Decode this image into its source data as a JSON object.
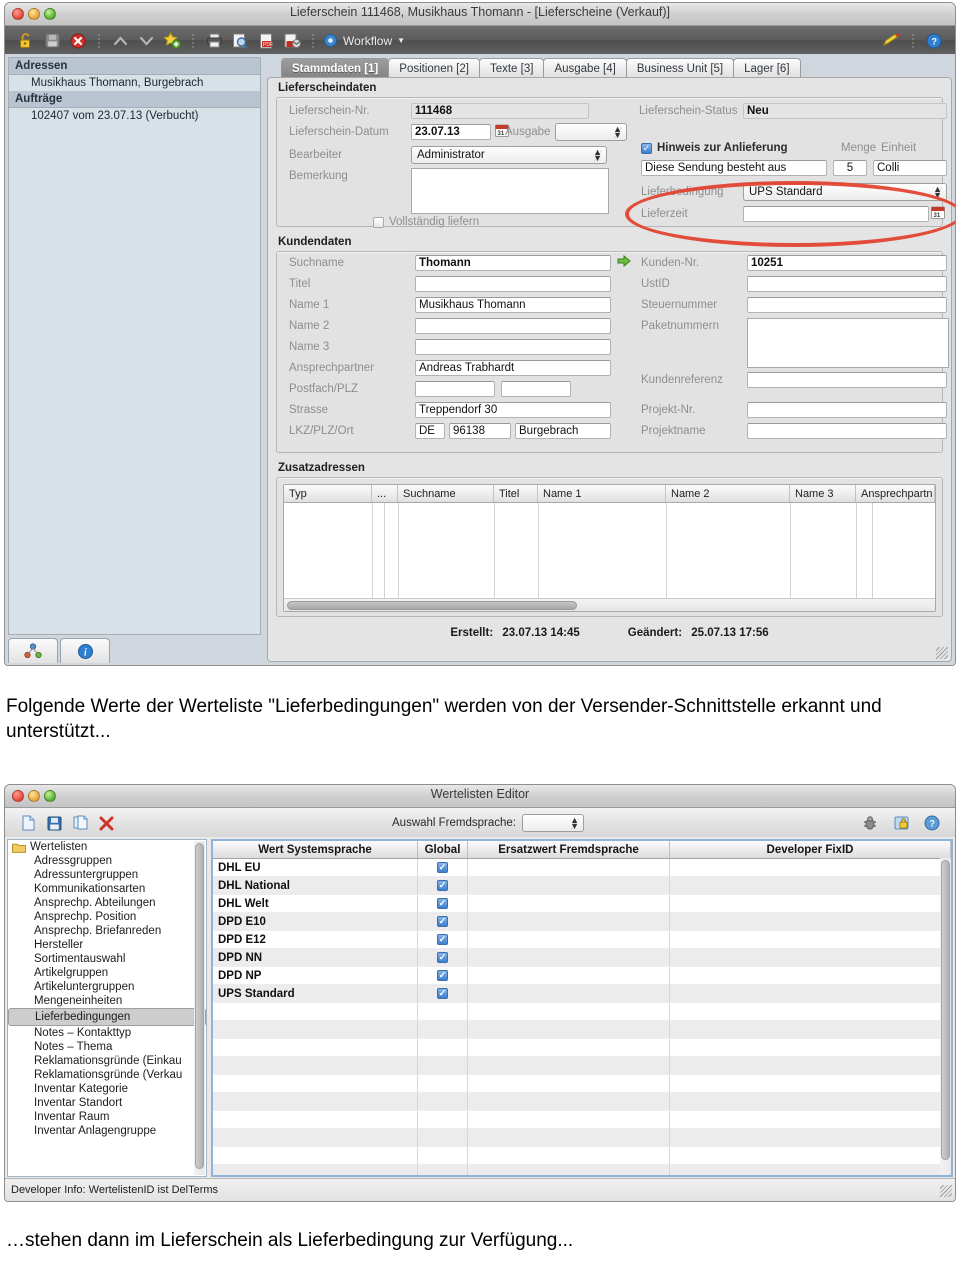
{
  "window1": {
    "title": "Lieferschein 111468, Musikhaus Thomann - [Lieferscheine (Verkauf)]",
    "toolbar": {
      "icons": [
        {
          "name": "unlock-icon",
          "glyph": "🔓"
        },
        {
          "name": "save-disk-icon",
          "glyph": "💾"
        },
        {
          "name": "delete-cancel-icon",
          "glyph": "✖"
        },
        {
          "name": "nav-up-icon",
          "glyph": "∧"
        },
        {
          "name": "nav-down-icon",
          "glyph": "∨"
        },
        {
          "name": "new-star-icon",
          "glyph": "★"
        },
        {
          "name": "print-icon",
          "glyph": "⎙"
        },
        {
          "name": "print-preview-icon",
          "glyph": "🔍"
        },
        {
          "name": "pdf-export-icon",
          "glyph": "📕"
        },
        {
          "name": "pdf-mail-icon",
          "glyph": "✉"
        }
      ],
      "workflow_label": "Workflow",
      "right_icons": [
        {
          "name": "highlight-pen-icon",
          "glyph": "✎"
        },
        {
          "name": "help-icon",
          "glyph": "?"
        }
      ]
    },
    "sidebar": {
      "groups": [
        {
          "label": "Adressen",
          "items": [
            "Musikhaus Thomann, Burgebrach"
          ]
        },
        {
          "label": "Aufträge",
          "items": [
            "102407 vom 23.07.13 (Verbucht)"
          ]
        }
      ],
      "bottom_tabs": [
        {
          "name": "relations-tab",
          "glyph": "⚬"
        },
        {
          "name": "info-tab",
          "glyph": "i"
        }
      ]
    },
    "tabs": [
      {
        "label": "Stammdaten [1]",
        "active": true
      },
      {
        "label": "Positionen [2]",
        "active": false
      },
      {
        "label": "Texte [3]",
        "active": false
      },
      {
        "label": "Ausgabe [4]",
        "active": false
      },
      {
        "label": "Business Unit [5]",
        "active": false
      },
      {
        "label": "Lager [6]",
        "active": false
      }
    ],
    "lieferscheindaten": {
      "group_title": "Lieferscheindaten",
      "nr_label": "Lieferschein-Nr.",
      "nr_value": "111468",
      "datum_label": "Lieferschein-Datum",
      "datum_value": "23.07.13",
      "ausgabe_label": "Ausgabe",
      "ausgabe_value": "",
      "bearbeiter_label": "Bearbeiter",
      "bearbeiter_value": "Administrator",
      "bemerkung_label": "Bemerkung",
      "bemerkung_value": "",
      "vollstaendig_label": "Vollständig liefern",
      "vollstaendig_checked": false,
      "status_label": "Lieferschein-Status",
      "status_value": "Neu",
      "hinweis_label": "Hinweis zur Anlieferung",
      "hinweis_checked": true,
      "hinweis_value": "Diese Sendung besteht aus",
      "menge_label": "Menge",
      "menge_value": "5",
      "einheit_label": "Einheit",
      "einheit_value": "Colli",
      "lieferbedingung_label": "Lieferbedingung",
      "lieferbedingung_value": "UPS Standard",
      "lieferzeit_label": "Lieferzeit",
      "lieferzeit_value": ""
    },
    "kundendaten": {
      "group_title": "Kundendaten",
      "left": [
        {
          "label": "Suchname",
          "value": "Thomann"
        },
        {
          "label": "Titel",
          "value": ""
        },
        {
          "label": "Name 1",
          "value": "Musikhaus Thomann"
        },
        {
          "label": "Name 2",
          "value": ""
        },
        {
          "label": "Name 3",
          "value": ""
        },
        {
          "label": "Ansprechpartner",
          "value": "Andreas Trabhardt"
        },
        {
          "label": "Postfach/PLZ",
          "value": ""
        },
        {
          "label": "Strasse",
          "value": "Treppendorf 30"
        }
      ],
      "lkz_label": "LKZ/PLZ/Ort",
      "lkz_value": "DE",
      "plz_value": "96138",
      "ort_value": "Burgebrach",
      "right": [
        {
          "label": "Kunden-Nr.",
          "value": "10251"
        },
        {
          "label": "UstID",
          "value": ""
        },
        {
          "label": "Steuernummer",
          "value": ""
        },
        {
          "label": "Paketnummern",
          "value": ""
        },
        {
          "label": "Kundenreferenz",
          "value": ""
        },
        {
          "label": "Projekt-Nr.",
          "value": ""
        },
        {
          "label": "Projektname",
          "value": ""
        }
      ]
    },
    "zusatzadressen": {
      "group_title": "Zusatzadressen",
      "columns": [
        "Typ",
        "...",
        "Suchname",
        "Titel",
        "Name 1",
        "Name 2",
        "Name 3",
        "Ansprechpartn"
      ],
      "rows": []
    },
    "footer": {
      "erstellt_label": "Erstellt:",
      "erstellt_value": "23.07.13  14:45",
      "geaendert_label": "Geändert:",
      "geaendert_value": "25.07.13  17:56"
    },
    "annotation": {
      "shape": "ellipse",
      "color": "#e2402c"
    }
  },
  "caption_top": "Folgende Werte der Werteliste \"Lieferbedingungen\" werden von der Versender-Schnittstelle erkannt und unterstützt...",
  "caption_bottom": "…stehen dann im Lieferschein als Lieferbedingung zur Verfügung...",
  "window2": {
    "title": "Wertelisten Editor",
    "toolbar": {
      "icons": [
        {
          "name": "new-document-icon",
          "glyph": "📄"
        },
        {
          "name": "save-icon",
          "glyph": "💾"
        },
        {
          "name": "duplicate-icon",
          "glyph": "⧉"
        },
        {
          "name": "delete-icon",
          "glyph": "✖"
        }
      ],
      "fremdsprache_label": "Auswahl Fremdsprache:",
      "fremdsprache_value": "",
      "right_icons": [
        {
          "name": "debug-bug-icon",
          "glyph": "⚙"
        },
        {
          "name": "lock-rights-icon",
          "glyph": "🔒"
        },
        {
          "name": "help-icon",
          "glyph": "?"
        }
      ]
    },
    "tree": {
      "root": "Wertelisten",
      "items": [
        {
          "label": "Adressgruppen",
          "selected": false
        },
        {
          "label": "Adressuntergruppen",
          "selected": false
        },
        {
          "label": "Kommunikationsarten",
          "selected": false
        },
        {
          "label": "Ansprechp. Abteilungen",
          "selected": false
        },
        {
          "label": "Ansprechp. Position",
          "selected": false
        },
        {
          "label": "Ansprechp. Briefanreden",
          "selected": false
        },
        {
          "label": "Hersteller",
          "selected": false
        },
        {
          "label": "Sortimentauswahl",
          "selected": false
        },
        {
          "label": "Artikelgruppen",
          "selected": false
        },
        {
          "label": "Artikeluntergruppen",
          "selected": false
        },
        {
          "label": "Mengeneinheiten",
          "selected": false
        },
        {
          "label": "Lieferbedingungen",
          "selected": true
        },
        {
          "label": "Notes – Kontakttyp",
          "selected": false
        },
        {
          "label": "Notes – Thema",
          "selected": false
        },
        {
          "label": "Reklamationsgründe (Einkau",
          "selected": false
        },
        {
          "label": "Reklamationsgründe (Verkau",
          "selected": false
        },
        {
          "label": "Inventar Kategorie",
          "selected": false
        },
        {
          "label": "Inventar Standort",
          "selected": false
        },
        {
          "label": "Inventar Raum",
          "selected": false
        },
        {
          "label": "Inventar Anlagengruppe",
          "selected": false
        }
      ]
    },
    "table": {
      "columns": [
        "Wert Systemsprache",
        "Global",
        "Ersatzwert Fremdsprache",
        "Developer FixID"
      ],
      "rows": [
        {
          "wert": "DHL EU",
          "global": true,
          "ersatzwert": "",
          "fixid": ""
        },
        {
          "wert": "DHL National",
          "global": true,
          "ersatzwert": "",
          "fixid": ""
        },
        {
          "wert": "DHL Welt",
          "global": true,
          "ersatzwert": "",
          "fixid": ""
        },
        {
          "wert": "DPD E10",
          "global": true,
          "ersatzwert": "",
          "fixid": ""
        },
        {
          "wert": "DPD E12",
          "global": true,
          "ersatzwert": "",
          "fixid": ""
        },
        {
          "wert": "DPD NN",
          "global": true,
          "ersatzwert": "",
          "fixid": ""
        },
        {
          "wert": "DPD NP",
          "global": true,
          "ersatzwert": "",
          "fixid": ""
        },
        {
          "wert": "UPS Standard",
          "global": true,
          "ersatzwert": "",
          "fixid": ""
        }
      ]
    },
    "statusbar": "Developer Info: WertelistenID ist DelTerms"
  }
}
